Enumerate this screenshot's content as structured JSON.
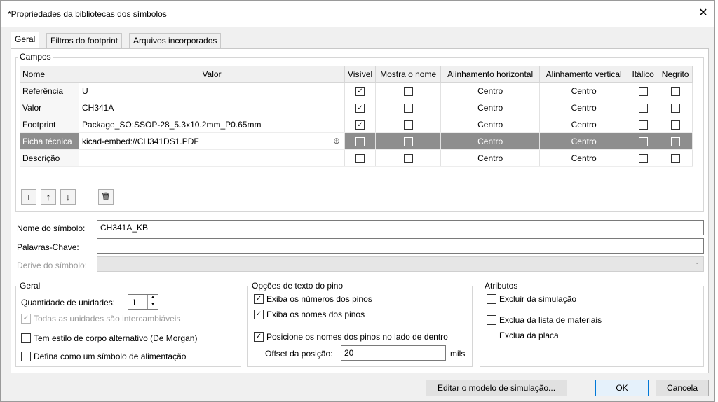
{
  "window": {
    "title": "*Propriedades da bibliotecas dos símbolos",
    "close_glyph": "✕"
  },
  "tabs": [
    {
      "label": "Geral",
      "active": true
    },
    {
      "label": "Filtros do footprint",
      "active": false
    },
    {
      "label": "Arquivos incorporados",
      "active": false
    }
  ],
  "fields": {
    "group_label": "Campos",
    "columns": [
      "Nome",
      "Valor",
      "Visível",
      "Mostra o nome",
      "Alinhamento horizontal",
      "Alinhamento vertical",
      "Itálico",
      "Negrito"
    ],
    "rows": [
      {
        "name": "Referência",
        "value": "U",
        "visible": true,
        "show_name": false,
        "h_align": "Centro",
        "v_align": "Centro",
        "italic": false,
        "bold": false,
        "selected": false
      },
      {
        "name": "Valor",
        "value": "CH341A",
        "visible": true,
        "show_name": false,
        "h_align": "Centro",
        "v_align": "Centro",
        "italic": false,
        "bold": false,
        "selected": false
      },
      {
        "name": "Footprint",
        "value": "Package_SO:SSOP-28_5.3x10.2mm_P0.65mm",
        "visible": true,
        "show_name": false,
        "h_align": "Centro",
        "v_align": "Centro",
        "italic": false,
        "bold": false,
        "selected": false
      },
      {
        "name": "Ficha técnica",
        "value": "kicad-embed://CH341DS1.PDF",
        "visible": false,
        "show_name": false,
        "h_align": "Centro",
        "v_align": "Centro",
        "italic": false,
        "bold": false,
        "selected": true
      },
      {
        "name": "Descrição",
        "value": "",
        "visible": false,
        "show_name": false,
        "h_align": "Centro",
        "v_align": "Centro",
        "italic": false,
        "bold": false,
        "selected": false
      }
    ],
    "toolbar": {
      "add": "+",
      "up": "↑",
      "down": "↓",
      "delete": "🗑"
    }
  },
  "symbol": {
    "name_label": "Nome do símbolo:",
    "name_value": "CH341A_KB",
    "keywords_label": "Palavras-Chave:",
    "keywords_value": "",
    "derive_label": "Derive do símbolo:",
    "derive_value": ""
  },
  "general": {
    "label": "Geral",
    "units_label": "Quantidade de unidades:",
    "units_value": "1",
    "interchangeable_label": "Todas as unidades são intercambiáveis",
    "interchangeable": true,
    "demorgan_label": "Tem estilo de corpo alternativo (De Morgan)",
    "demorgan": false,
    "power_label": "Defina como um símbolo de alimentação",
    "power": false
  },
  "pin_text": {
    "label": "Opções de texto do pino",
    "show_numbers_label": "Exiba os números dos pinos",
    "show_numbers": true,
    "show_names_label": "Exiba os nomes dos pinos",
    "show_names": true,
    "inside_label": "Posicione os nomes dos pinos no lado de dentro",
    "inside": true,
    "offset_label": "Offset da posição:",
    "offset_value": "20",
    "offset_unit": "mils"
  },
  "attributes": {
    "label": "Atributos",
    "exclude_sim_label": "Excluir da simulação",
    "exclude_sim": false,
    "exclude_bom_label": "Exclua da lista de materiais",
    "exclude_bom": false,
    "exclude_board_label": "Exclua da placa",
    "exclude_board": false
  },
  "buttons": {
    "sim_model": "Editar o modelo de simulação...",
    "ok": "OK",
    "cancel": "Cancela"
  }
}
